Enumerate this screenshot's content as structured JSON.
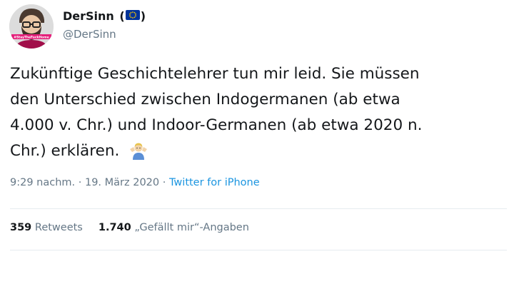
{
  "user": {
    "display_name": "DerSinn",
    "flag_open": "(",
    "flag_close": ")",
    "flag_icon": "eu-flag-icon",
    "handle": "@DerSinn",
    "avatar_caption": "#StayTheFuckHome"
  },
  "tweet": {
    "lines": [
      "Zukünftige Geschichtelehrer tun mir leid. Sie müssen",
      "den Unterschied zwischen Indogermanen (ab etwa",
      "4.000 v. Chr.) und Indoor-Germanen (ab etwa 2020 n.",
      "Chr.) erklären."
    ],
    "emoji_icon": "man-shrugging-emoji-icon"
  },
  "meta": {
    "time": "9:29 nachm.",
    "separator": " · ",
    "date": "19. März 2020",
    "separator2": " · ",
    "source": "Twitter for iPhone"
  },
  "stats": {
    "retweets_count": "359",
    "retweets_label": " Retweets",
    "likes_count": "1.740",
    "likes_label": " „Gefällt mir“-Angaben"
  },
  "colors": {
    "text": "#14171a",
    "secondary": "#657786",
    "link": "#1b95e0",
    "divider": "#e6ecf0",
    "eu_blue": "#003399",
    "eu_star": "#ffcc00"
  }
}
